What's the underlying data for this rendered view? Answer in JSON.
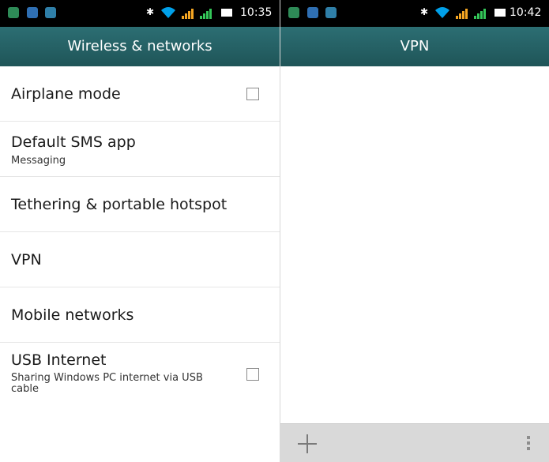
{
  "left_screen": {
    "status_bar": {
      "time": "10:35"
    },
    "title": "Wireless & networks",
    "items": [
      {
        "title": "Airplane mode",
        "subtitle": ""
      },
      {
        "title": "Default SMS app",
        "subtitle": "Messaging"
      },
      {
        "title": "Tethering & portable hotspot",
        "subtitle": ""
      },
      {
        "title": "VPN",
        "subtitle": ""
      },
      {
        "title": "Mobile networks",
        "subtitle": ""
      },
      {
        "title": "USB Internet",
        "subtitle": "Sharing Windows PC internet via USB cable"
      }
    ],
    "checkboxes": {
      "airplane_mode_checked": false,
      "usb_internet_checked": false
    }
  },
  "right_screen": {
    "status_bar": {
      "time": "10:42"
    },
    "title": "VPN"
  },
  "colors": {
    "titlebar": "#1f5558",
    "status_bar": "#000000",
    "bottom_bar": "#d9d9d9"
  },
  "icons": [
    "photo-icon",
    "usb-icon",
    "message-icon",
    "bluetooth-icon",
    "wifi-icon",
    "signal-icon",
    "battery-icon",
    "add-icon",
    "overflow-menu-icon"
  ]
}
